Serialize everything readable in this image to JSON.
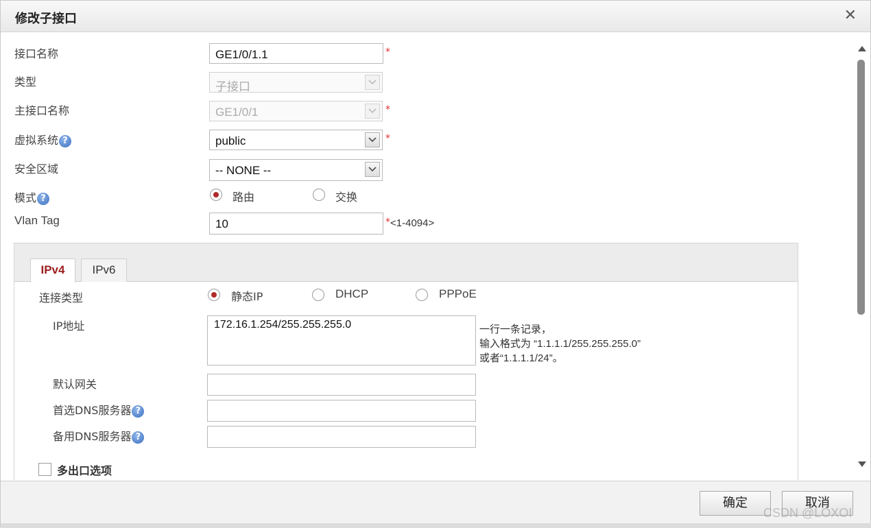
{
  "dialog": {
    "title": "修改子接口",
    "close_glyph": "✕"
  },
  "fields": {
    "interface_name": {
      "label": "接口名称",
      "value": "GE1/0/1.1",
      "required": "*"
    },
    "type": {
      "label": "类型",
      "value": "子接口"
    },
    "main_interface": {
      "label": "主接口名称",
      "value": "GE1/0/1",
      "required": "*"
    },
    "virtual_system": {
      "label": "虚拟系统",
      "value": "public",
      "required": "*"
    },
    "security_zone": {
      "label": "安全区域",
      "value": "-- NONE --"
    },
    "mode": {
      "label": "模式",
      "options": [
        "路由",
        "交换"
      ],
      "selected": "路由"
    },
    "vlan_tag": {
      "label": "Vlan Tag",
      "value": "10",
      "required": "*",
      "range_hint": "<1-4094>"
    }
  },
  "help_glyph": "?",
  "tabs": [
    {
      "label": "IPv4",
      "active": true
    },
    {
      "label": "IPv6",
      "active": false
    }
  ],
  "ipv4": {
    "connection_type": {
      "label": "连接类型",
      "options": [
        "静态IP",
        "DHCP",
        "PPPoE"
      ],
      "selected": "静态IP"
    },
    "ip_address": {
      "label": "IP地址",
      "value": "172.16.1.254/255.255.255.0",
      "hint_lines": [
        "一行一条记录，",
        "输入格式为 “1.1.1.1/255.255.255.0”",
        "或者“1.1.1.1/24”。"
      ]
    },
    "default_gateway": {
      "label": "默认网关",
      "value": ""
    },
    "primary_dns": {
      "label": "首选DNS服务器",
      "value": ""
    },
    "secondary_dns": {
      "label": "备用DNS服务器",
      "value": ""
    },
    "multi_exit": {
      "label": "多出口选项",
      "checked": false
    }
  },
  "footer": {
    "ok_label": "确定",
    "cancel_label": "取消"
  },
  "watermark": "CSDN @LOXOI",
  "colors": {
    "accent": "#9b1e1e",
    "required": "#e03030",
    "help": "#3c6fc0"
  }
}
